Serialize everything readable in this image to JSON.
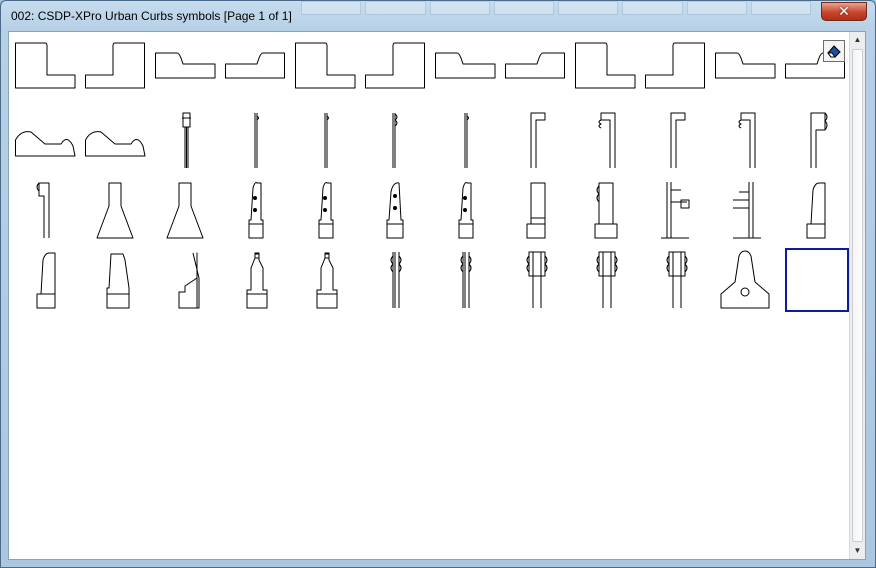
{
  "window": {
    "title": "002: CSDP-XPro Urban Curbs symbols [Page 1 of 1]",
    "close_label": "✕"
  },
  "toolbar": {
    "button_icon": "eraser-icon"
  },
  "colors": {
    "symbol_stroke": "#000000",
    "selection_border": "#0b1d9a",
    "close": "#c7452c"
  },
  "grid": {
    "columns": 12,
    "rows": [
      [
        "curb-a",
        "curb-a-mirror",
        "curb-b",
        "curb-b-mirror",
        "curb-a",
        "curb-a-mirror",
        "curb-b",
        "curb-b-mirror",
        "curb-a",
        "curb-a-mirror",
        "curb-b",
        "curb-b-mirror"
      ],
      [
        "mound",
        "mound",
        "pin",
        "edge-1",
        "edge-1",
        "edge-2",
        "edge-1",
        "flag-1",
        "flag-2",
        "flag-1",
        "flag-2",
        "flag-3"
      ],
      [
        "flag-4",
        "trapezoid",
        "trapezoid",
        "tower-1",
        "tower-1",
        "tower-2",
        "tower-1",
        "block-1",
        "block-2",
        "rail-1",
        "rail-2",
        "block-3"
      ],
      [
        "block-3",
        "block-4",
        "block-5",
        "block-6",
        "block-6",
        "double-1",
        "double-1",
        "double-2",
        "double-2",
        "double-2",
        "keyhole",
        "empty"
      ]
    ],
    "selected_index": 47
  }
}
